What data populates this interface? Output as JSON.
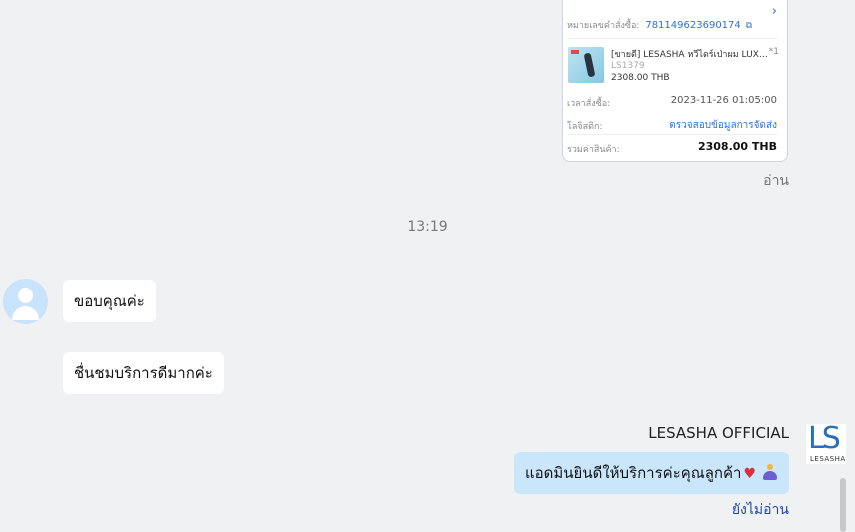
{
  "order_card": {
    "order_no_label": "หมายเลขคำสั่งซื้อ:",
    "order_no": "781149623690174",
    "product_name": "[ขายดี] LESASHA หวีไดร์เป่าผม LUXE H...",
    "product_qty": "*1",
    "product_sku": "LS1379",
    "product_price": "2308.00 THB",
    "order_time_label": "เวลาสั่งซื้อ:",
    "order_time": "2023-11-26 01:05:00",
    "logistics_label": "โลจิสติก:",
    "logistics_link": "ตรวจสอบข้อมูลการจัดส่ง",
    "total_label": "รวมค่าสินค้า:",
    "total": "2308.00 THB"
  },
  "card_read_status": "อ่าน",
  "timestamp": "13:19",
  "messages_in": [
    "ขอบคุณค่ะ",
    "ชื่นชมบริการดีมากค่ะ"
  ],
  "sender_name": "LESASHA OFFICIAL",
  "brand_logo": {
    "mark": "LS",
    "word": "LESASHA"
  },
  "message_out": "แอดมินยินดีให้บริการค่ะคุณลูกค้า",
  "unread_status": "ยังไม่อ่าน",
  "icons": {
    "open_order": "chevron-right-icon",
    "copy": "copy-icon",
    "avatar": "user-avatar-icon",
    "heart": "red-heart-emoji",
    "pray": "folded-hands-emoji"
  },
  "colors": {
    "accent_link": "#2f6fd6",
    "outgoing_bubble": "#c9e6fb",
    "incoming_bubble": "#ffffff",
    "background": "#f0f1f3",
    "unread": "#1c47a8",
    "brand": "#2b6fb8"
  }
}
